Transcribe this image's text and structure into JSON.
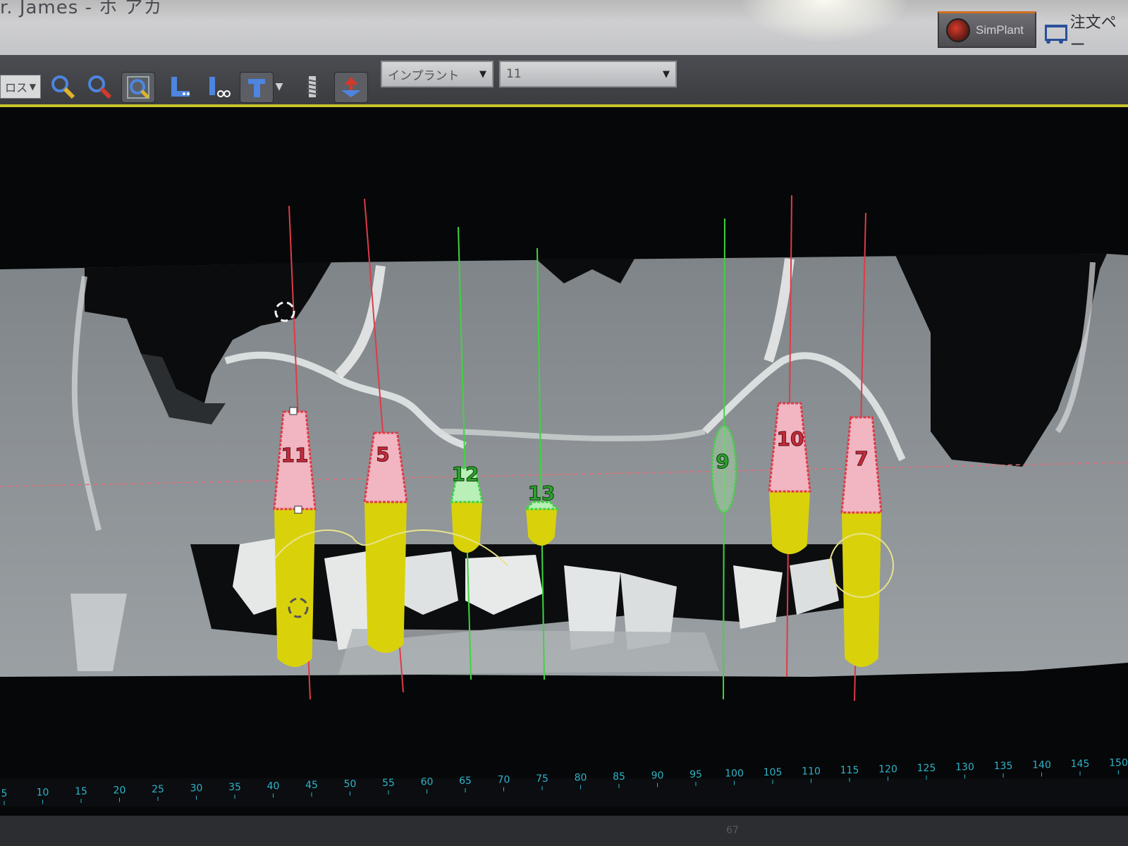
{
  "window": {
    "title_fragment": "r. James  -  ホ  アカ"
  },
  "header": {
    "simplant_label": "SimPlant",
    "order_label": "注文ペー"
  },
  "toolbar": {
    "view_combo": "ロス",
    "type_select": "インプラント",
    "id_select": "11",
    "tools": [
      "zoom-in-icon",
      "zoom-out-icon",
      "zoom-fit-icon",
      "nerve-icon",
      "nerve-edit-icon",
      "implant-icon",
      "implant-dropdown-icon",
      "screw-icon",
      "flip-icon"
    ]
  },
  "viewer": {
    "mode": "panoramic CT reformat",
    "implants": [
      {
        "label": "11",
        "color": "red",
        "selected": true
      },
      {
        "label": "5",
        "color": "red"
      },
      {
        "label": "12",
        "color": "green"
      },
      {
        "label": "13",
        "color": "green"
      },
      {
        "label": "9",
        "color": "green"
      },
      {
        "label": "10",
        "color": "red"
      },
      {
        "label": "7",
        "color": "red"
      }
    ],
    "ruler_ticks": [
      "5",
      "10",
      "15",
      "20",
      "25",
      "30",
      "35",
      "40",
      "45",
      "50",
      "55",
      "60",
      "65",
      "70",
      "75",
      "80",
      "85",
      "90",
      "95",
      "100",
      "105",
      "110",
      "115",
      "120",
      "125",
      "130",
      "135",
      "140",
      "145",
      "150"
    ],
    "ruler_value": "67"
  },
  "colors": {
    "accent_yellow": "#c9c32a",
    "implant_red": "#e03a48",
    "implant_pink": "#f1b6c2",
    "implant_green": "#3fd43f",
    "implant_yellow": "#d9d20b",
    "ruler_text": "#2fb3c8"
  }
}
